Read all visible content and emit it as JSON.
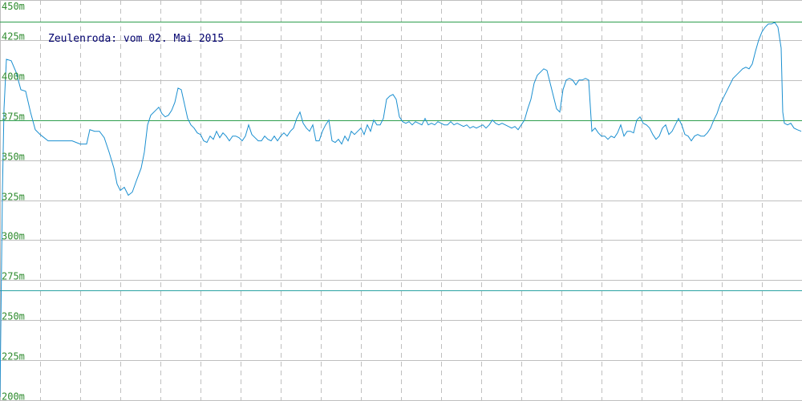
{
  "chart_data": {
    "type": "line",
    "title": "Zeulenroda: vom 02. Mai 2015",
    "xlabel": "",
    "ylabel": "",
    "ylim": [
      200,
      450
    ],
    "xlim": [
      0,
      1000
    ],
    "y_ticks": [
      "450m",
      "425m",
      "400m",
      "375m",
      "350m",
      "325m",
      "300m",
      "275m",
      "250m",
      "225m",
      "200m"
    ],
    "grid": true,
    "reference_lines": {
      "max": 436.5,
      "avg": 375,
      "min": 268.5
    },
    "colors": {
      "line": "#1a8fd0",
      "ref_max_avg": "#2e9e4e",
      "ref_min": "#2aa3a3",
      "grid": "#bfbfbf",
      "tick_text": "#2e8b2e",
      "title_text": "#00006e"
    },
    "series": [
      {
        "values": [
          [
            0,
            202
          ],
          [
            3,
            330
          ],
          [
            5,
            382
          ],
          [
            8,
            413
          ],
          [
            14,
            412
          ],
          [
            20,
            405
          ],
          [
            26,
            394
          ],
          [
            32,
            393
          ],
          [
            38,
            380
          ],
          [
            44,
            369
          ],
          [
            50,
            366
          ],
          [
            60,
            362
          ],
          [
            70,
            362
          ],
          [
            80,
            362
          ],
          [
            90,
            362
          ],
          [
            100,
            360
          ],
          [
            108,
            360
          ],
          [
            112,
            369
          ],
          [
            118,
            368
          ],
          [
            124,
            368
          ],
          [
            130,
            364
          ],
          [
            136,
            355
          ],
          [
            142,
            345
          ],
          [
            146,
            335
          ],
          [
            150,
            331
          ],
          [
            155,
            333
          ],
          [
            160,
            328
          ],
          [
            165,
            330
          ],
          [
            170,
            337
          ],
          [
            176,
            345
          ],
          [
            180,
            355
          ],
          [
            184,
            372
          ],
          [
            188,
            378
          ],
          [
            194,
            381
          ],
          [
            198,
            383
          ],
          [
            202,
            379
          ],
          [
            206,
            377
          ],
          [
            210,
            378
          ],
          [
            214,
            381
          ],
          [
            218,
            386
          ],
          [
            222,
            395
          ],
          [
            226,
            394
          ],
          [
            230,
            385
          ],
          [
            234,
            376
          ],
          [
            238,
            372
          ],
          [
            242,
            370
          ],
          [
            246,
            367
          ],
          [
            250,
            366
          ],
          [
            254,
            362
          ],
          [
            258,
            361
          ],
          [
            262,
            365
          ],
          [
            266,
            363
          ],
          [
            270,
            368
          ],
          [
            274,
            364
          ],
          [
            278,
            367
          ],
          [
            282,
            365
          ],
          [
            286,
            362
          ],
          [
            290,
            365
          ],
          [
            294,
            365
          ],
          [
            298,
            364
          ],
          [
            302,
            362
          ],
          [
            306,
            365
          ],
          [
            310,
            372
          ],
          [
            314,
            366
          ],
          [
            318,
            364
          ],
          [
            322,
            362
          ],
          [
            326,
            362
          ],
          [
            330,
            365
          ],
          [
            334,
            363
          ],
          [
            338,
            362
          ],
          [
            342,
            365
          ],
          [
            346,
            362
          ],
          [
            350,
            365
          ],
          [
            354,
            367
          ],
          [
            358,
            365
          ],
          [
            362,
            368
          ],
          [
            366,
            370
          ],
          [
            370,
            376
          ],
          [
            374,
            380
          ],
          [
            378,
            373
          ],
          [
            382,
            370
          ],
          [
            386,
            368
          ],
          [
            390,
            372
          ],
          [
            394,
            362
          ],
          [
            398,
            362
          ],
          [
            402,
            368
          ],
          [
            406,
            372
          ],
          [
            410,
            375
          ],
          [
            414,
            362
          ],
          [
            418,
            361
          ],
          [
            422,
            363
          ],
          [
            426,
            360
          ],
          [
            430,
            365
          ],
          [
            434,
            362
          ],
          [
            438,
            368
          ],
          [
            442,
            366
          ],
          [
            446,
            368
          ],
          [
            450,
            370
          ],
          [
            454,
            366
          ],
          [
            458,
            372
          ],
          [
            462,
            368
          ],
          [
            466,
            375
          ],
          [
            470,
            372
          ],
          [
            474,
            372
          ],
          [
            478,
            376
          ],
          [
            482,
            388
          ],
          [
            486,
            390
          ],
          [
            490,
            391
          ],
          [
            494,
            388
          ],
          [
            498,
            377
          ],
          [
            502,
            374
          ],
          [
            506,
            373
          ],
          [
            510,
            374
          ],
          [
            514,
            372
          ],
          [
            518,
            374
          ],
          [
            522,
            373
          ],
          [
            526,
            372
          ],
          [
            530,
            376
          ],
          [
            534,
            372
          ],
          [
            538,
            373
          ],
          [
            542,
            372
          ],
          [
            546,
            374
          ],
          [
            550,
            373
          ],
          [
            554,
            372
          ],
          [
            558,
            372
          ],
          [
            562,
            374
          ],
          [
            566,
            372
          ],
          [
            570,
            373
          ],
          [
            574,
            372
          ],
          [
            578,
            371
          ],
          [
            582,
            372
          ],
          [
            586,
            370
          ],
          [
            590,
            371
          ],
          [
            594,
            370
          ],
          [
            598,
            371
          ],
          [
            602,
            372
          ],
          [
            606,
            370
          ],
          [
            610,
            372
          ],
          [
            614,
            375
          ],
          [
            618,
            373
          ],
          [
            622,
            372
          ],
          [
            626,
            373
          ],
          [
            630,
            372
          ],
          [
            634,
            371
          ],
          [
            638,
            370
          ],
          [
            642,
            371
          ],
          [
            646,
            369
          ],
          [
            650,
            372
          ],
          [
            654,
            375
          ],
          [
            658,
            382
          ],
          [
            662,
            388
          ],
          [
            666,
            398
          ],
          [
            670,
            403
          ],
          [
            674,
            405
          ],
          [
            678,
            407
          ],
          [
            682,
            406
          ],
          [
            686,
            398
          ],
          [
            690,
            390
          ],
          [
            694,
            382
          ],
          [
            698,
            380
          ],
          [
            702,
            394
          ],
          [
            706,
            400
          ],
          [
            710,
            401
          ],
          [
            714,
            400
          ],
          [
            718,
            397
          ],
          [
            722,
            400
          ],
          [
            726,
            400
          ],
          [
            730,
            401
          ],
          [
            734,
            400
          ],
          [
            738,
            368
          ],
          [
            742,
            370
          ],
          [
            746,
            367
          ],
          [
            750,
            365
          ],
          [
            754,
            365
          ],
          [
            758,
            363
          ],
          [
            762,
            365
          ],
          [
            766,
            364
          ],
          [
            770,
            367
          ],
          [
            774,
            372
          ],
          [
            778,
            365
          ],
          [
            782,
            368
          ],
          [
            786,
            368
          ],
          [
            790,
            367
          ],
          [
            794,
            375
          ],
          [
            798,
            377
          ],
          [
            802,
            373
          ],
          [
            806,
            372
          ],
          [
            810,
            370
          ],
          [
            814,
            366
          ],
          [
            818,
            363
          ],
          [
            822,
            365
          ],
          [
            826,
            370
          ],
          [
            830,
            372
          ],
          [
            834,
            366
          ],
          [
            838,
            368
          ],
          [
            842,
            372
          ],
          [
            846,
            376
          ],
          [
            850,
            372
          ],
          [
            854,
            366
          ],
          [
            858,
            365
          ],
          [
            862,
            362
          ],
          [
            866,
            365
          ],
          [
            870,
            366
          ],
          [
            874,
            365
          ],
          [
            878,
            365
          ],
          [
            882,
            367
          ],
          [
            886,
            370
          ],
          [
            890,
            375
          ],
          [
            894,
            379
          ],
          [
            898,
            385
          ],
          [
            902,
            389
          ],
          [
            906,
            393
          ],
          [
            910,
            397
          ],
          [
            914,
            401
          ],
          [
            918,
            403
          ],
          [
            922,
            405
          ],
          [
            926,
            407
          ],
          [
            930,
            408
          ],
          [
            934,
            407
          ],
          [
            938,
            410
          ],
          [
            942,
            418
          ],
          [
            946,
            425
          ],
          [
            950,
            430
          ],
          [
            954,
            433
          ],
          [
            958,
            435
          ],
          [
            962,
            435
          ],
          [
            966,
            436
          ],
          [
            970,
            433
          ],
          [
            974,
            420
          ],
          [
            976,
            380
          ],
          [
            978,
            373
          ],
          [
            982,
            372
          ],
          [
            986,
            373
          ],
          [
            990,
            370
          ],
          [
            994,
            369
          ],
          [
            999,
            368
          ]
        ]
      }
    ]
  }
}
